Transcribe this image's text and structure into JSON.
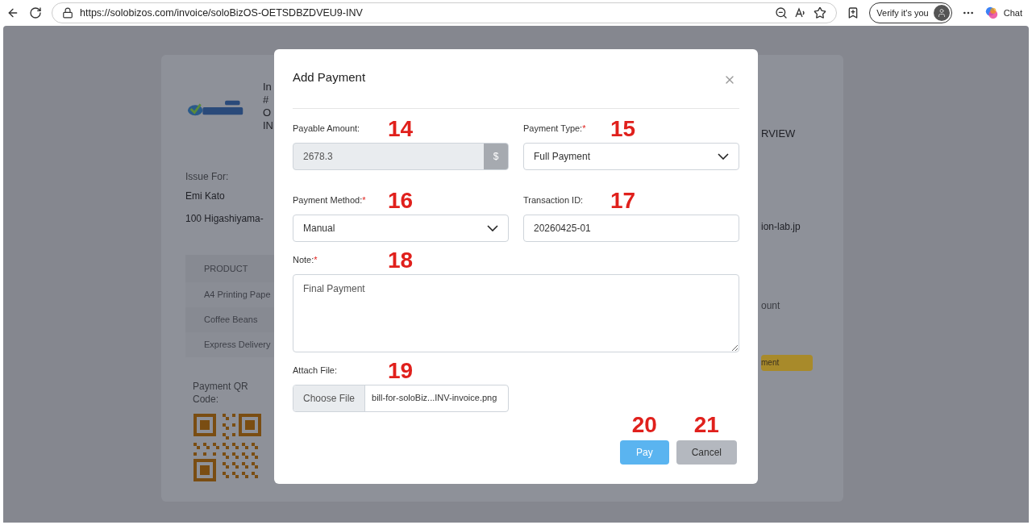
{
  "browser": {
    "url": "https://solobizos.com/invoice/soloBizOS-OETSDBZDVEU9-INV",
    "profile_button": "Verify it's you",
    "chat_button": "Chat"
  },
  "background_page": {
    "invoice_title_lines": [
      "In",
      "#",
      "O",
      "IN"
    ],
    "issue_label": "Issue For:",
    "customer_name": "Emi Kato",
    "customer_address": "100 Higashiyama-",
    "table_header": "PRODUCT",
    "table_rows": [
      "A4 Printing Pape",
      "Coffee Beans",
      "Express Delivery"
    ],
    "qr_label": "Payment QR Code:",
    "overview_heading": "RVIEW",
    "email_fragment": "ion-lab.jp",
    "amount_fragment": "ount",
    "payment_button": "ment"
  },
  "modal": {
    "title": "Add Payment",
    "fields": [
      {
        "kind": "amount",
        "label": "Payable Amount:",
        "value": "2678.3",
        "addon": "$",
        "disabled": true,
        "marker": "14"
      },
      {
        "kind": "select",
        "label": "Payment Type:",
        "required_mark": "*",
        "value": "Full Payment",
        "disabled": false,
        "marker": "15"
      },
      {
        "kind": "select",
        "label": "Payment Method:",
        "required_mark": "*",
        "value": "Manual",
        "disabled": false,
        "marker": "16"
      },
      {
        "kind": "text",
        "label": "Transaction ID:",
        "value": "20260425-01",
        "disabled": false,
        "marker": "17"
      },
      {
        "kind": "textarea",
        "label": "Note:",
        "required_mark": "*",
        "value": "Final Payment",
        "disabled": false,
        "marker": "18"
      },
      {
        "kind": "file",
        "label": "Attach File:",
        "button": "Choose File",
        "value": "bill-for-soloBiz...INV-invoice.png",
        "disabled": false,
        "marker": "19"
      }
    ],
    "buttons": [
      {
        "kind": "primary",
        "label": "Pay",
        "marker": "20"
      },
      {
        "kind": "secondary",
        "label": "Cancel",
        "marker": "21"
      }
    ]
  }
}
